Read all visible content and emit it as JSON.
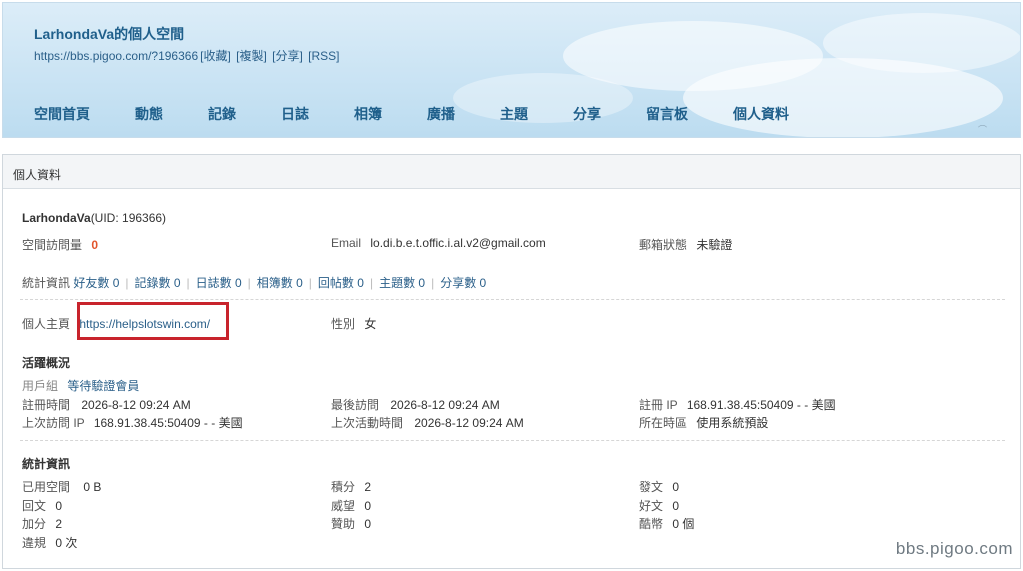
{
  "header": {
    "title": "LarhondaVa的個人空間",
    "url": "https://bbs.pigoo.com/?196366",
    "actions": [
      "[收藏]",
      "[複製]",
      "[分享]",
      "[RSS]"
    ]
  },
  "nav": [
    {
      "label": "空間首頁"
    },
    {
      "label": "動態"
    },
    {
      "label": "記錄"
    },
    {
      "label": "日誌"
    },
    {
      "label": "相簿"
    },
    {
      "label": "廣播"
    },
    {
      "label": "主題"
    },
    {
      "label": "分享"
    },
    {
      "label": "留言板"
    },
    {
      "label": "個人資料"
    }
  ],
  "panel": {
    "title": "個人資料",
    "username": "LarhondaVa",
    "uid": "(UID: 196366)",
    "visits_label": "空間訪問量",
    "visits_value": "0",
    "email_label": "Email",
    "email_value": "lo.di.b.e.t.offic.i.al.v2@gmail.com",
    "email_status_label": "郵箱狀態",
    "email_status_value": "未驗證",
    "stats_label": "統計資訊",
    "stats_links": [
      "好友數 0",
      "記錄數 0",
      "日誌數 0",
      "相簿數 0",
      "回帖數 0",
      "主題數 0",
      "分享數 0"
    ],
    "homepage_label": "個人主頁",
    "homepage_value": "https://helpslotswin.com/",
    "gender_label": "性別",
    "gender_value": "女",
    "activity": {
      "title": "活躍概況",
      "group_label": "用戶組",
      "group_value": "等待驗證會員",
      "reg_time_label": "註冊時間",
      "reg_time_value": "2026-8-12 09:24 AM",
      "last_visit_label": "最後訪問",
      "last_visit_value": "2026-8-12 09:24 AM",
      "reg_ip_label": "註冊 IP",
      "reg_ip_value": "168.91.38.45:50409 - - 美國",
      "last_ip_label": "上次訪問 IP",
      "last_ip_value": "168.91.38.45:50409 - - 美國",
      "last_active_label": "上次活動時間",
      "last_active_value": "2026-8-12 09:24 AM",
      "timezone_label": "所在時區",
      "timezone_value": "使用系統預設"
    },
    "stats": {
      "title": "統計資訊",
      "space_label": "已用空間",
      "space_value": "0 B",
      "points_label": "積分",
      "points_value": "2",
      "posts_label": "發文",
      "posts_value": "0",
      "replies_label": "回文",
      "replies_value": "0",
      "prestige_label": "威望",
      "prestige_value": "0",
      "good_label": "好文",
      "good_value": "0",
      "bonus_label": "加分",
      "bonus_value": "2",
      "sponsor_label": "贊助",
      "sponsor_value": "0",
      "coins_label": "酷幣",
      "coins_value": "0 個",
      "violations_label": "違規",
      "violations_value": "0 次"
    }
  },
  "watermark": "bbs.pigoo.com"
}
